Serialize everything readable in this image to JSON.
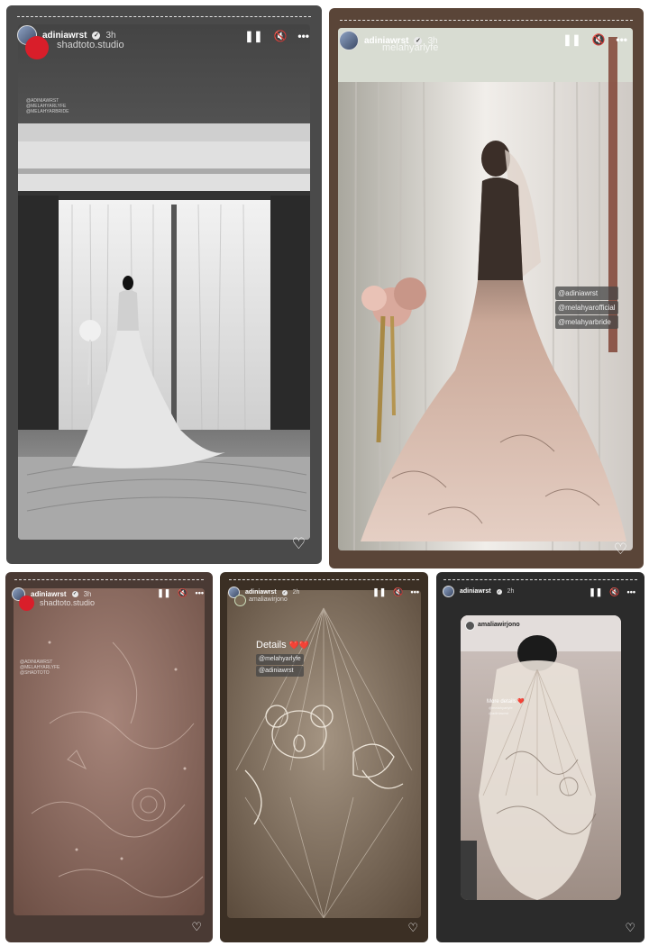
{
  "stories": [
    {
      "username": "adiniawrst",
      "time": "3h",
      "subtitle": "shadtoto.studio",
      "tags": [
        "@ADINIAWRST",
        "@MELAHYARLYFE",
        "@MELAHYARBRIDE"
      ]
    },
    {
      "username": "adiniawrst",
      "time": "3h",
      "subtitle": "melahyarlyfe",
      "tags": [
        "@adiniawrst",
        "@melahyarofficial",
        "@melahyarbride"
      ]
    },
    {
      "username": "adiniawrst",
      "time": "3h",
      "subtitle": "shadtoto.studio",
      "tags": [
        "@ADINIAWRST",
        "@MELAHYARLYFE",
        "@SHADTOTO"
      ]
    },
    {
      "username": "adiniawrst",
      "time": "2h",
      "subtitle": "amaliawirjono",
      "caption": "Details",
      "caption_emoji": "❤️❤️",
      "tags": [
        "@melahyarlyfe",
        "@adiniawrst"
      ]
    },
    {
      "username": "adiniawrst",
      "time": "2h",
      "embedded_user": "amaliawirjono",
      "caption": "More details",
      "caption_emoji": "❤️",
      "tags": [
        "@melahyarlyfe",
        "@adiniawrst"
      ]
    }
  ],
  "icons": {
    "pause": "pause-icon",
    "mute": "mute-icon",
    "more": "more-icon",
    "like": "heart-icon",
    "verified": "verified-icon"
  },
  "colors": {
    "frame_gray": "#4a4a4a",
    "frame_brown": "#5a4538",
    "frame_dark": "#2b2b2b"
  }
}
